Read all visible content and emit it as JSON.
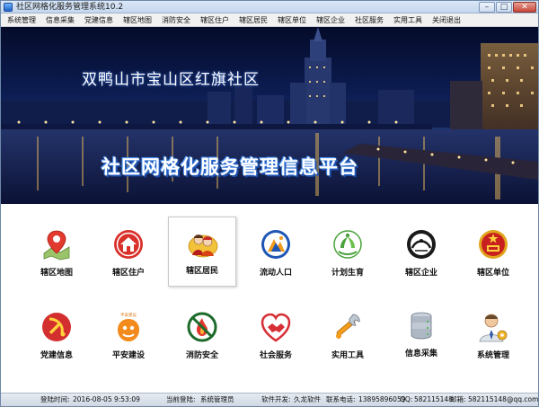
{
  "window": {
    "title": "社区网格化服务管理系统10.2",
    "minimize": "–",
    "maximize": "□",
    "close": "✕"
  },
  "menu": [
    "系统管理",
    "信息采集",
    "党建信息",
    "辖区地图",
    "消防安全",
    "辖区住户",
    "辖区居民",
    "辖区单位",
    "辖区企业",
    "社区服务",
    "实用工具",
    "关闭退出"
  ],
  "banner": {
    "community_name": "双鸭山市宝山区红旗社区",
    "platform_title": "社区网格化服务管理信息平台"
  },
  "modules": [
    {
      "label": "辖区地图",
      "icon": "map-pin-icon"
    },
    {
      "label": "辖区住户",
      "icon": "house-icon"
    },
    {
      "label": "辖区居民",
      "icon": "residents-icon",
      "selected": true
    },
    {
      "label": "流动人口",
      "icon": "migrant-icon"
    },
    {
      "label": "计划生育",
      "icon": "family-planning-icon"
    },
    {
      "label": "辖区企业",
      "icon": "enterprise-icon"
    },
    {
      "label": "辖区单位",
      "icon": "emblem-icon"
    },
    {
      "label": "党建信息",
      "icon": "party-emblem-icon"
    },
    {
      "label": "平安建设",
      "icon": "safety-icon"
    },
    {
      "label": "消防安全",
      "icon": "no-fire-icon"
    },
    {
      "label": "社会服务",
      "icon": "handshake-heart-icon"
    },
    {
      "label": "实用工具",
      "icon": "tools-icon"
    },
    {
      "label": "信息采集",
      "icon": "database-icon"
    },
    {
      "label": "系统管理",
      "icon": "admin-user-icon"
    }
  ],
  "safety_icon_text": "平安建设",
  "status": {
    "login_time_label": "登陆时间:",
    "login_time": "2016-08-05 9:53:09",
    "current_user_label": "当前登陆:",
    "current_user": "系统管理员",
    "developer_label": "软件开发:",
    "developer": "久龙软件",
    "phone_label": "联系电话:",
    "phone": "13895896059",
    "qq_label": "QQ:",
    "qq": "582115148",
    "email_label": "邮箱:",
    "email": "582115148@qq.com"
  },
  "colors": {
    "menubar": "#f1f1f1",
    "banner_sky": "#0c1d52",
    "title_blue": "#1c4aa8"
  }
}
